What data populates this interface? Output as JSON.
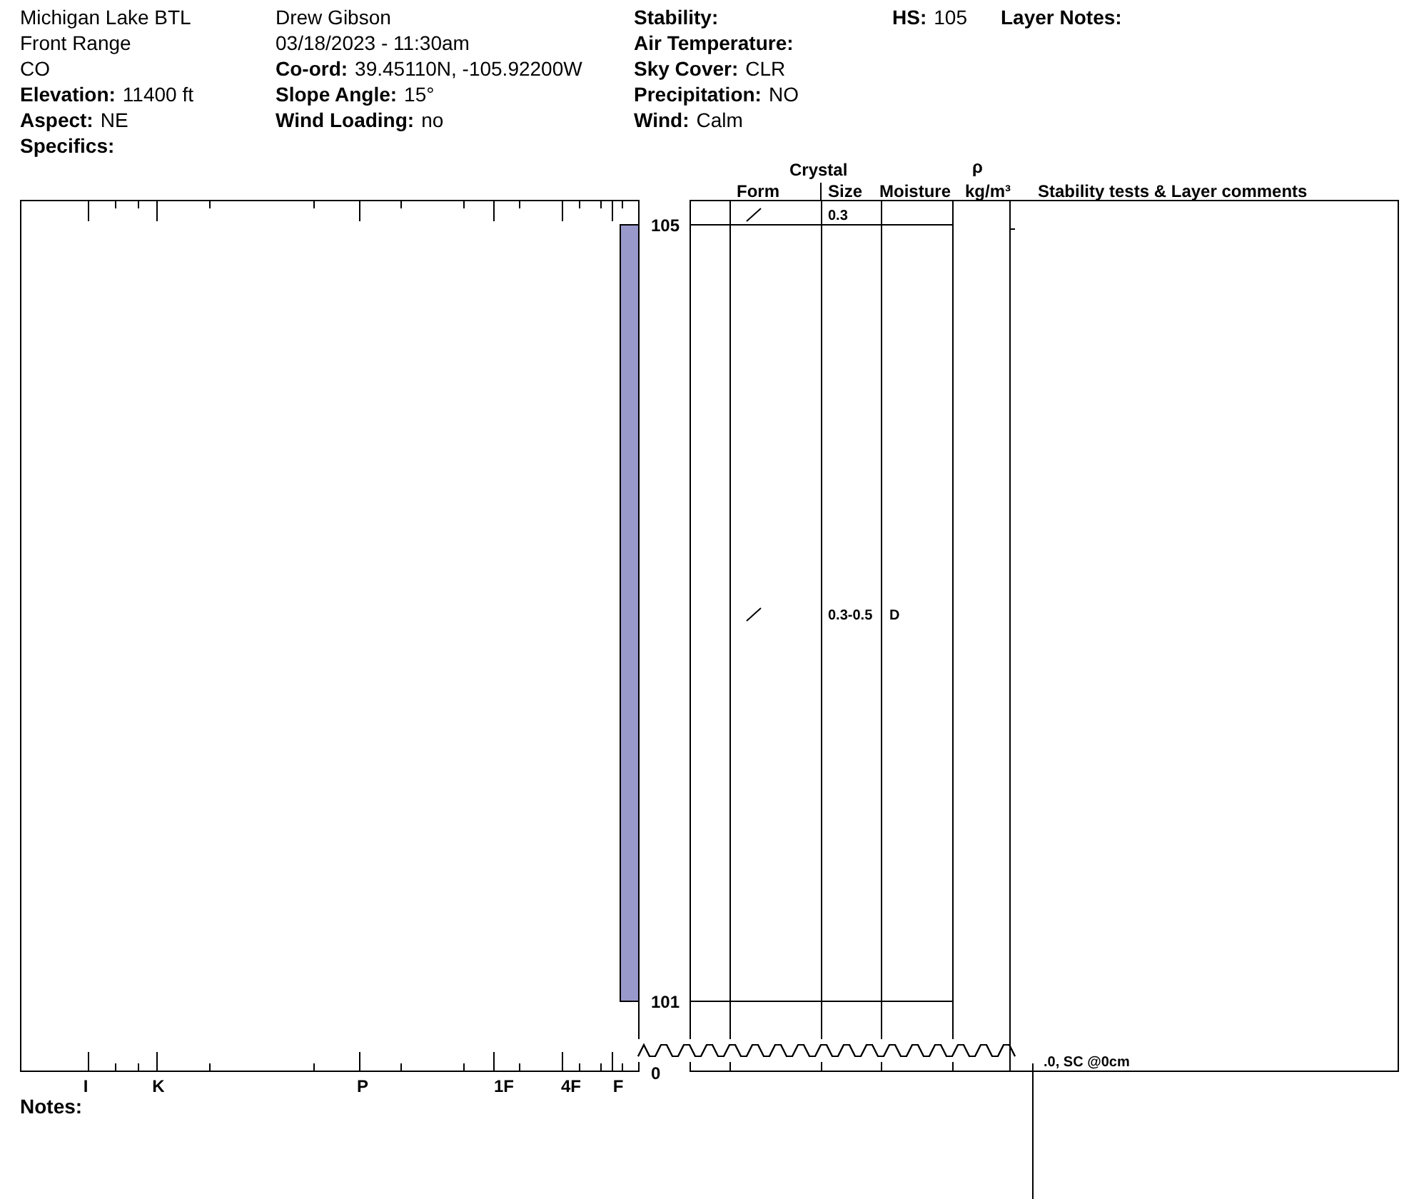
{
  "header": {
    "columns": [
      [
        {
          "value": "Michigan Lake BTL"
        },
        {
          "value": "Front Range"
        },
        {
          "value": "CO"
        },
        {
          "label": "Elevation:",
          "value": "11400 ft"
        },
        {
          "label": "Aspect:",
          "value": "NE"
        },
        {
          "label": "Specifics:"
        }
      ],
      [
        {
          "value": "Drew Gibson"
        },
        {
          "value": "03/18/2023 - 11:30am"
        },
        {
          "label": "Co-ord:",
          "value": "39.45110N, -105.92200W"
        },
        {
          "label": "Slope Angle:",
          "value": "15°"
        },
        {
          "label": "Wind Loading:",
          "value": "no"
        }
      ],
      [
        {
          "label": "Stability:"
        },
        {
          "label": "Air Temperature:"
        },
        {
          "label": "Sky Cover:",
          "value": "CLR"
        },
        {
          "label": "Precipitation:",
          "value": "NO"
        },
        {
          "label": "Wind:",
          "value": "Calm"
        }
      ],
      [
        {
          "label": "HS:",
          "value": "105"
        }
      ],
      [
        {
          "label": "Layer Notes:"
        }
      ]
    ]
  },
  "table": {
    "group_heading": "Crystal",
    "columns": [
      "Form",
      "Size",
      "Moisture",
      "kg/m³",
      "Stability tests & Layer comments"
    ],
    "rho": "ρ"
  },
  "hardness_axis": [
    "I",
    "K",
    "P",
    "1F",
    "4F",
    "F"
  ],
  "height_labels": [
    "105",
    "101",
    "0"
  ],
  "layers": [
    {
      "kind": "slash",
      "size": "0.3"
    },
    {
      "kind": "slash",
      "size": "0.3-0.5",
      "moisture": "D"
    }
  ],
  "stability_test": ".0, SC @0cm",
  "notes_label": "Notes:"
}
